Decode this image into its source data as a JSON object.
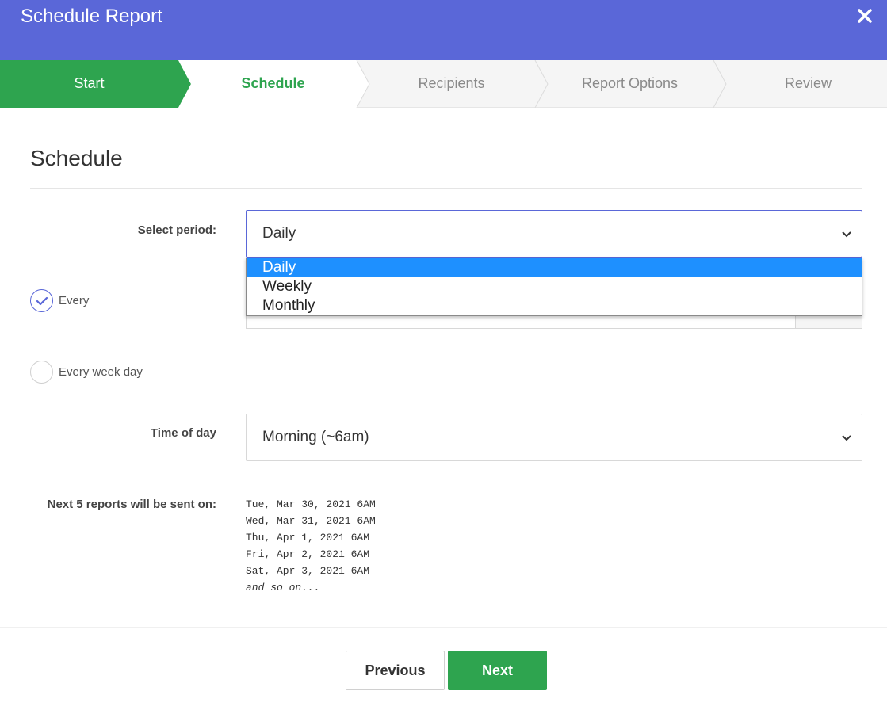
{
  "dialog": {
    "title": "Schedule Report"
  },
  "steps": [
    {
      "label": "Start",
      "state": "done"
    },
    {
      "label": "Schedule",
      "state": "active"
    },
    {
      "label": "Recipients",
      "state": "pending"
    },
    {
      "label": "Report Options",
      "state": "pending"
    },
    {
      "label": "Review",
      "state": "pending"
    }
  ],
  "section": {
    "title": "Schedule"
  },
  "period": {
    "label": "Select period:",
    "value": "Daily",
    "options": [
      "Daily",
      "Weekly",
      "Monthly"
    ],
    "highlighted": "Daily"
  },
  "frequency": {
    "every_label": "Every",
    "every_checked": true,
    "weekday_label": "Every week day",
    "weekday_checked": false
  },
  "time_of_day": {
    "label": "Time of day",
    "value": "Morning (~6am)"
  },
  "next_reports": {
    "label": "Next 5 reports will be sent on:",
    "dates": [
      "Tue, Mar 30, 2021 6AM",
      "Wed, Mar 31, 2021 6AM",
      "Thu, Apr 1, 2021 6AM",
      "Fri, Apr 2, 2021 6AM",
      "Sat, Apr 3, 2021 6AM"
    ],
    "more": "and so on..."
  },
  "footer": {
    "previous_label": "Previous",
    "next_label": "Next"
  },
  "colors": {
    "header": "#5a67d8",
    "accent_green": "#2ea44f",
    "selected_option": "#1e90ff",
    "step_inactive_bg": "#f5f5f5",
    "step_inactive_text": "#8a8a8a"
  },
  "icons": {
    "close": "close-icon",
    "chevron": "chevron-down-icon",
    "check": "check-icon"
  }
}
